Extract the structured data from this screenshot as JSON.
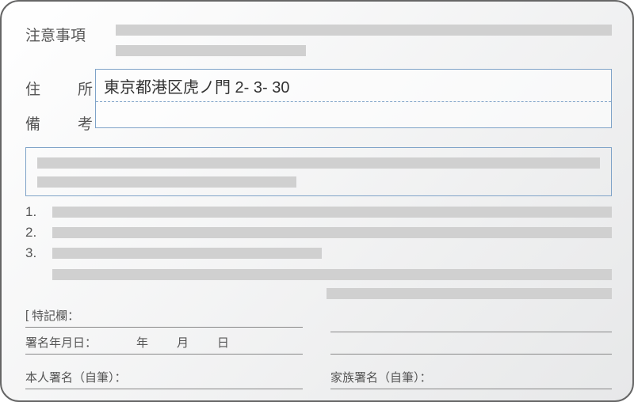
{
  "notice": {
    "label": "注意事項"
  },
  "address": {
    "label": "住　所",
    "value": "東京都港区虎ノ門 2- 3- 30"
  },
  "remarks": {
    "label": "備　考"
  },
  "list": {
    "n1": "1.",
    "n2": "2.",
    "n3": "3."
  },
  "special": {
    "bracket": "[",
    "label": "特記欄：",
    "date_label": "署名年月日：",
    "year": "年",
    "month": "月",
    "day": "日"
  },
  "sign_self": {
    "label": "本人署名（自筆）："
  },
  "sign_family": {
    "label": "家族署名（自筆）："
  }
}
